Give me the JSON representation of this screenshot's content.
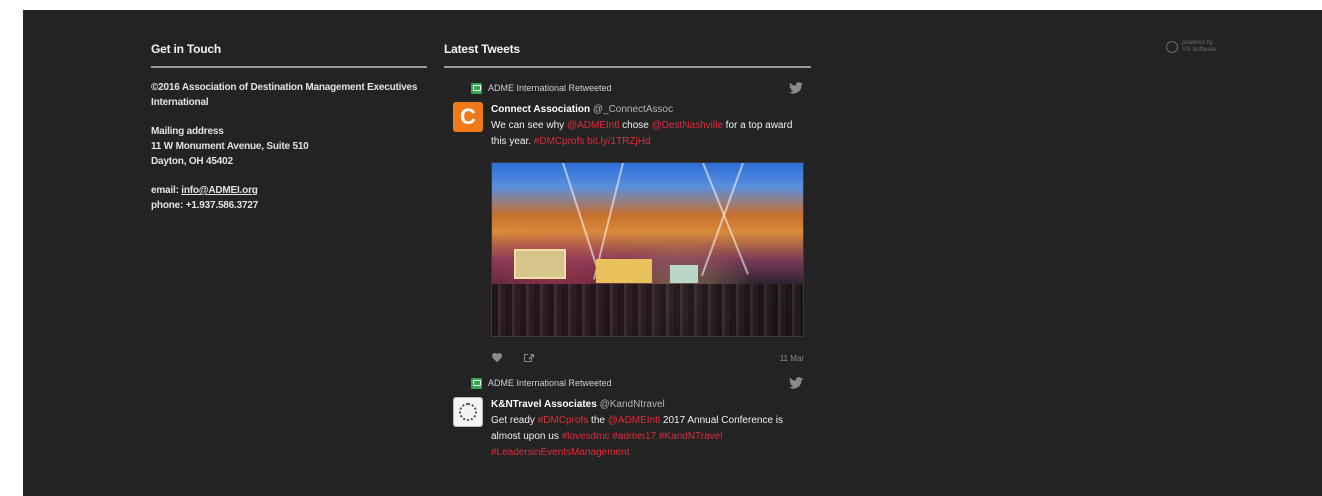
{
  "contact": {
    "heading": "Get in Touch",
    "copyright": "©2016 Association of Destination Management Executives International",
    "mailing_label": "Mailing address",
    "address_line1": "11 W Monument Avenue, Suite 510",
    "address_line2": "Dayton, OH 45402",
    "email_prefix": "email: ",
    "email": "info@ADMEI.org",
    "phone": "phone: +1.937.586.3727"
  },
  "tweets": {
    "heading": "Latest Tweets",
    "items": [
      {
        "retweeted_by": "ADME International Retweeted",
        "author": "Connect Association",
        "handle": "@_ConnectAssoc",
        "text_1": "We can see why ",
        "mention_1": "@ADMEIntl",
        "text_2": " chose ",
        "mention_2": "@DestNashville",
        "text_3": " for a top award this year. ",
        "hashtag_1": "#DMCprofs",
        "link": "bit.ly/1TRZjHd",
        "date": "11 Mar",
        "avatar_letter": "C"
      },
      {
        "retweeted_by": "ADME International Retweeted",
        "author": "K&NTravel Associates",
        "handle": "@KandNtravel",
        "text_1": "Get ready ",
        "hashtag_1": "#DMCprofs",
        "text_2": " the ",
        "mention_1": "@ADMEIntl",
        "text_3": " 2017 Annual Conference is almost upon us ",
        "hashtag_2": "#lovesdmc",
        "hashtag_3": "#admei17",
        "hashtag_4": "#KandNTravel",
        "hashtag_5": "#LeadersinEventsManagement"
      }
    ]
  },
  "powered_by": {
    "line1": "powered by",
    "line2": "YG Software"
  },
  "colors": {
    "background": "#232323",
    "link_red": "#e02a3a",
    "retweet_green": "#36a64f",
    "avatar_orange": "#f07a19"
  },
  "icons": [
    "retweet-icon",
    "twitter-bird-icon",
    "heart-icon",
    "share-icon"
  ]
}
